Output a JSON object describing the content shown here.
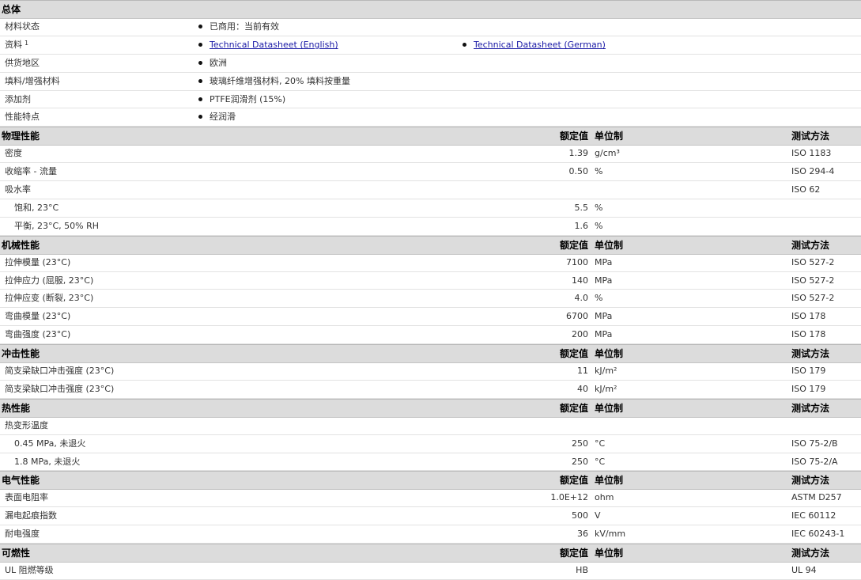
{
  "general": {
    "title": "总体",
    "rows": [
      {
        "label": "材料状态",
        "items": [
          {
            "text": "已商用：当前有效"
          }
        ]
      },
      {
        "label": "资料",
        "sup": "1",
        "items": [
          {
            "text": "Technical Datasheet (English)",
            "link": true
          },
          {
            "text": "Technical Datasheet (German)",
            "link": true
          }
        ]
      },
      {
        "label": "供货地区",
        "items": [
          {
            "text": "欧洲"
          }
        ]
      },
      {
        "label": "填料/增强材料",
        "items": [
          {
            "text": "玻璃纤维增强材料, 20% 填料按重量"
          }
        ]
      },
      {
        "label": "添加剂",
        "items": [
          {
            "text": "PTFE润滑剂 (15%)"
          }
        ]
      },
      {
        "label": "性能特点",
        "items": [
          {
            "text": "经润滑"
          }
        ]
      }
    ]
  },
  "headers": {
    "value": "额定值",
    "unit": "单位制",
    "method": "测试方法"
  },
  "sections": [
    {
      "title": "物理性能",
      "rows": [
        {
          "label": "密度",
          "value": "1.39",
          "unit": "g/cm³",
          "method": "ISO 1183"
        },
        {
          "label": "收缩率 - 流量",
          "value": "0.50",
          "unit": "%",
          "method": "ISO 294-4"
        },
        {
          "label": "吸水率",
          "value": "",
          "unit": "",
          "method": "ISO 62"
        },
        {
          "label": "饱和, 23°C",
          "value": "5.5",
          "unit": "%",
          "method": "",
          "sub": true
        },
        {
          "label": "平衡, 23°C, 50% RH",
          "value": "1.6",
          "unit": "%",
          "method": "",
          "sub": true
        }
      ]
    },
    {
      "title": "机械性能",
      "rows": [
        {
          "label": "拉伸模量 (23°C)",
          "value": "7100",
          "unit": "MPa",
          "method": "ISO 527-2"
        },
        {
          "label": "拉伸应力 (屈服, 23°C)",
          "value": "140",
          "unit": "MPa",
          "method": "ISO 527-2"
        },
        {
          "label": "拉伸应变 (断裂, 23°C)",
          "value": "4.0",
          "unit": "%",
          "method": "ISO 527-2"
        },
        {
          "label": "弯曲模量 (23°C)",
          "value": "6700",
          "unit": "MPa",
          "method": "ISO 178"
        },
        {
          "label": "弯曲强度 (23°C)",
          "value": "200",
          "unit": "MPa",
          "method": "ISO 178"
        }
      ]
    },
    {
      "title": "冲击性能",
      "rows": [
        {
          "label": "简支梁缺口冲击强度 (23°C)",
          "value": "11",
          "unit": "kJ/m²",
          "method": "ISO 179"
        },
        {
          "label": "简支梁缺口冲击强度 (23°C)",
          "value": "40",
          "unit": "kJ/m²",
          "method": "ISO 179"
        }
      ]
    },
    {
      "title": "热性能",
      "rows": [
        {
          "label": "热变形温度",
          "value": "",
          "unit": "",
          "method": ""
        },
        {
          "label": "0.45 MPa, 未退火",
          "value": "250",
          "unit": "°C",
          "method": "ISO 75-2/B",
          "sub": true
        },
        {
          "label": "1.8 MPa, 未退火",
          "value": "250",
          "unit": "°C",
          "method": "ISO 75-2/A",
          "sub": true
        }
      ]
    },
    {
      "title": "电气性能",
      "rows": [
        {
          "label": "表面电阻率",
          "value": "1.0E+12",
          "unit": "ohm",
          "method": "ASTM D257"
        },
        {
          "label": "漏电起痕指数",
          "value": "500",
          "unit": "V",
          "method": "IEC 60112"
        },
        {
          "label": "耐电强度",
          "value": "36",
          "unit": "kV/mm",
          "method": "IEC 60243-1"
        }
      ]
    },
    {
      "title": "可燃性",
      "rows": [
        {
          "label": "UL 阻燃等级",
          "value": "HB",
          "unit": "",
          "method": "UL 94"
        }
      ]
    }
  ]
}
